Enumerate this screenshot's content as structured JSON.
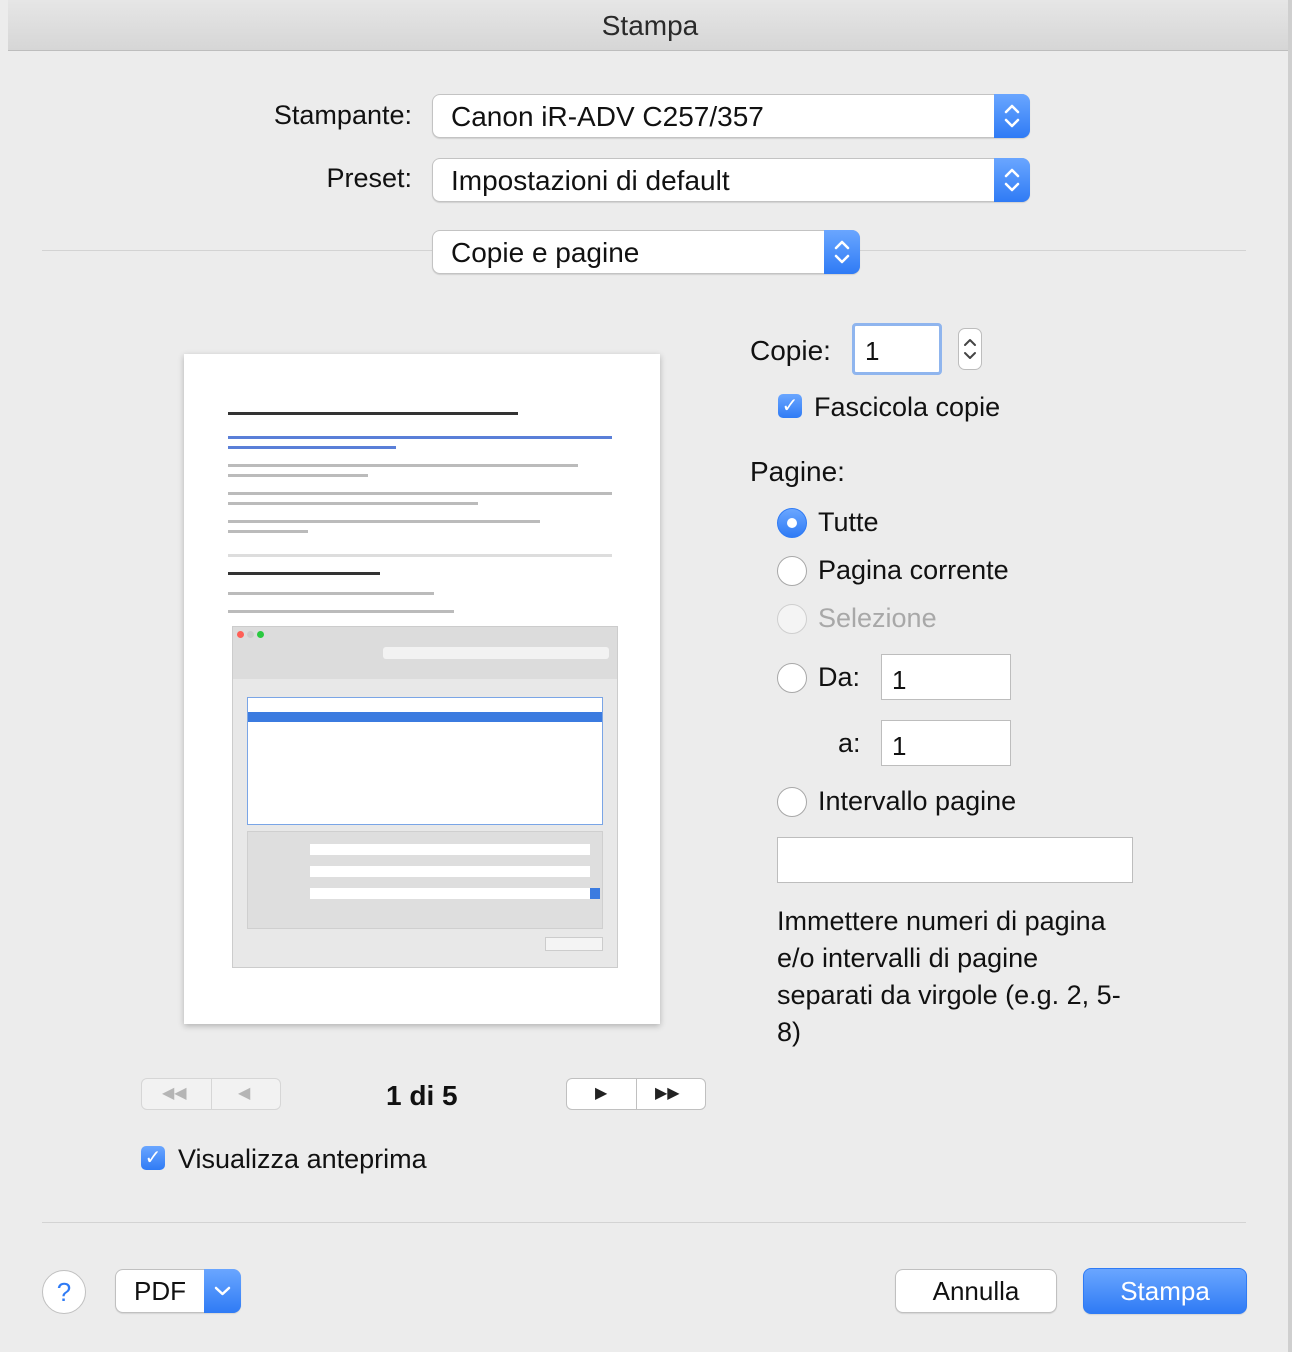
{
  "window": {
    "title": "Stampa"
  },
  "printer": {
    "label": "Stampante:",
    "value": "Canon iR-ADV C257/357"
  },
  "preset": {
    "label": "Preset:",
    "value": "Impostazioni di default"
  },
  "section": {
    "value": "Copie e pagine"
  },
  "copies": {
    "label": "Copie:",
    "value": "1",
    "collate_label": "Fascicola copie",
    "collate_checked": true
  },
  "pages": {
    "label": "Pagine:",
    "options": [
      {
        "label": "Tutte",
        "selected": true,
        "enabled": true
      },
      {
        "label": "Pagina corrente",
        "selected": false,
        "enabled": true
      },
      {
        "label": "Selezione",
        "selected": false,
        "enabled": false
      }
    ],
    "from_label": "Da:",
    "from_value": "1",
    "to_label": "a:",
    "to_value": "1",
    "range_label": "Intervallo pagine",
    "range_value": "",
    "hint": "Immettere numeri di pagina e/o intervalli di pagine separati da virgole (e.g. 2, 5-8)"
  },
  "navigation": {
    "page_indicator": "1 di 5"
  },
  "show_preview": {
    "label": "Visualizza anteprima",
    "checked": true
  },
  "footer": {
    "help": "?",
    "pdf": "PDF",
    "cancel": "Annulla",
    "print": "Stampa"
  },
  "colors": {
    "accent": "#2f7bf5",
    "background": "#ececec"
  }
}
